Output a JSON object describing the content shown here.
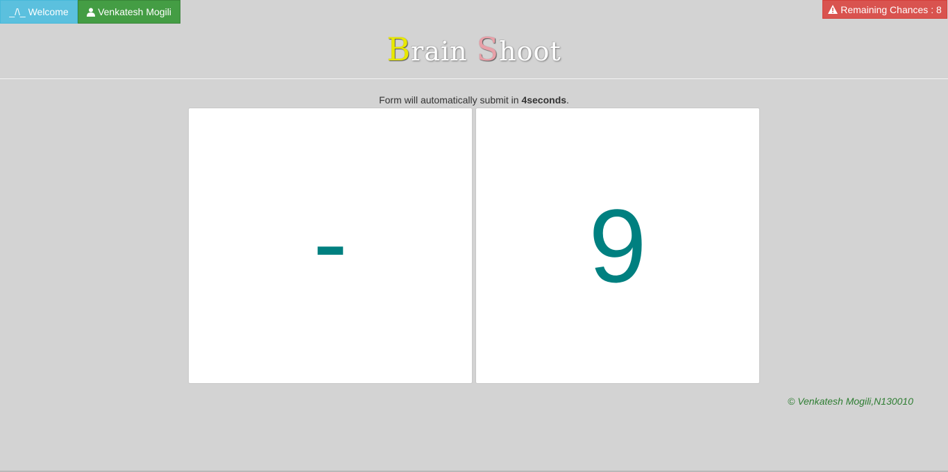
{
  "header": {
    "welcome_label": "_/\\_ Welcome",
    "user_name": "Venkatesh Mogili",
    "chances_label": "Remaining Chances : 8"
  },
  "logo": {
    "part1_cap": "B",
    "part1_rest": "rain ",
    "part2_cap": "S",
    "part2_rest": "hoot"
  },
  "notice": {
    "prefix": "Form will automatically submit in ",
    "countdown": "4seconds",
    "suffix": "."
  },
  "cards": {
    "left_value": "-",
    "right_value": "9"
  },
  "footer": {
    "copyright": "© Venkatesh Mogili,N130010"
  },
  "colors": {
    "welcome_bg": "#5bc0de",
    "user_bg": "#449d44",
    "chances_bg": "#d9534f",
    "card_value": "#008080",
    "footer_text": "#2e7d32"
  },
  "icons": {
    "user": "user-icon",
    "warning": "warning-icon"
  }
}
